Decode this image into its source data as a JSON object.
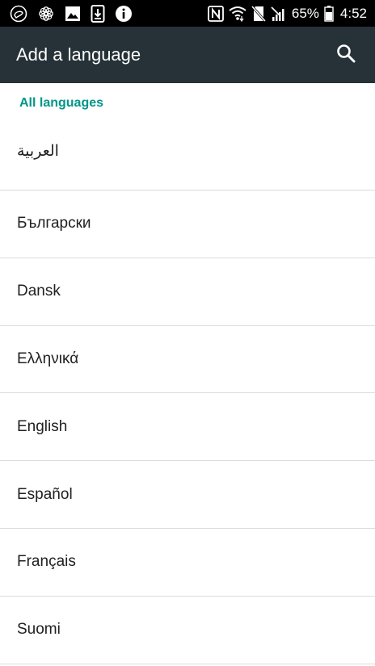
{
  "status_bar": {
    "left_icons": [
      "messenger-icon",
      "flower-icon",
      "gallery-icon",
      "download-icon",
      "info-icon"
    ],
    "right_icons": [
      "nfc-icon",
      "wifi-icon",
      "no-sim-icon",
      "no-signal-icon"
    ],
    "battery_percent": "65%",
    "time": "4:52"
  },
  "app_bar": {
    "title": "Add a language",
    "search_icon": "search-icon"
  },
  "list": {
    "section_header": "All languages",
    "languages": [
      {
        "label": "العربية"
      },
      {
        "label": "Български"
      },
      {
        "label": "Dansk"
      },
      {
        "label": "Ελληνικά"
      },
      {
        "label": "English"
      },
      {
        "label": "Español"
      },
      {
        "label": "Français"
      },
      {
        "label": "Suomi"
      }
    ]
  },
  "colors": {
    "status_bar_bg": "#000000",
    "app_bar_bg": "#263238",
    "accent": "#009688",
    "text_primary": "#212121",
    "divider": "#dcdcdc"
  }
}
